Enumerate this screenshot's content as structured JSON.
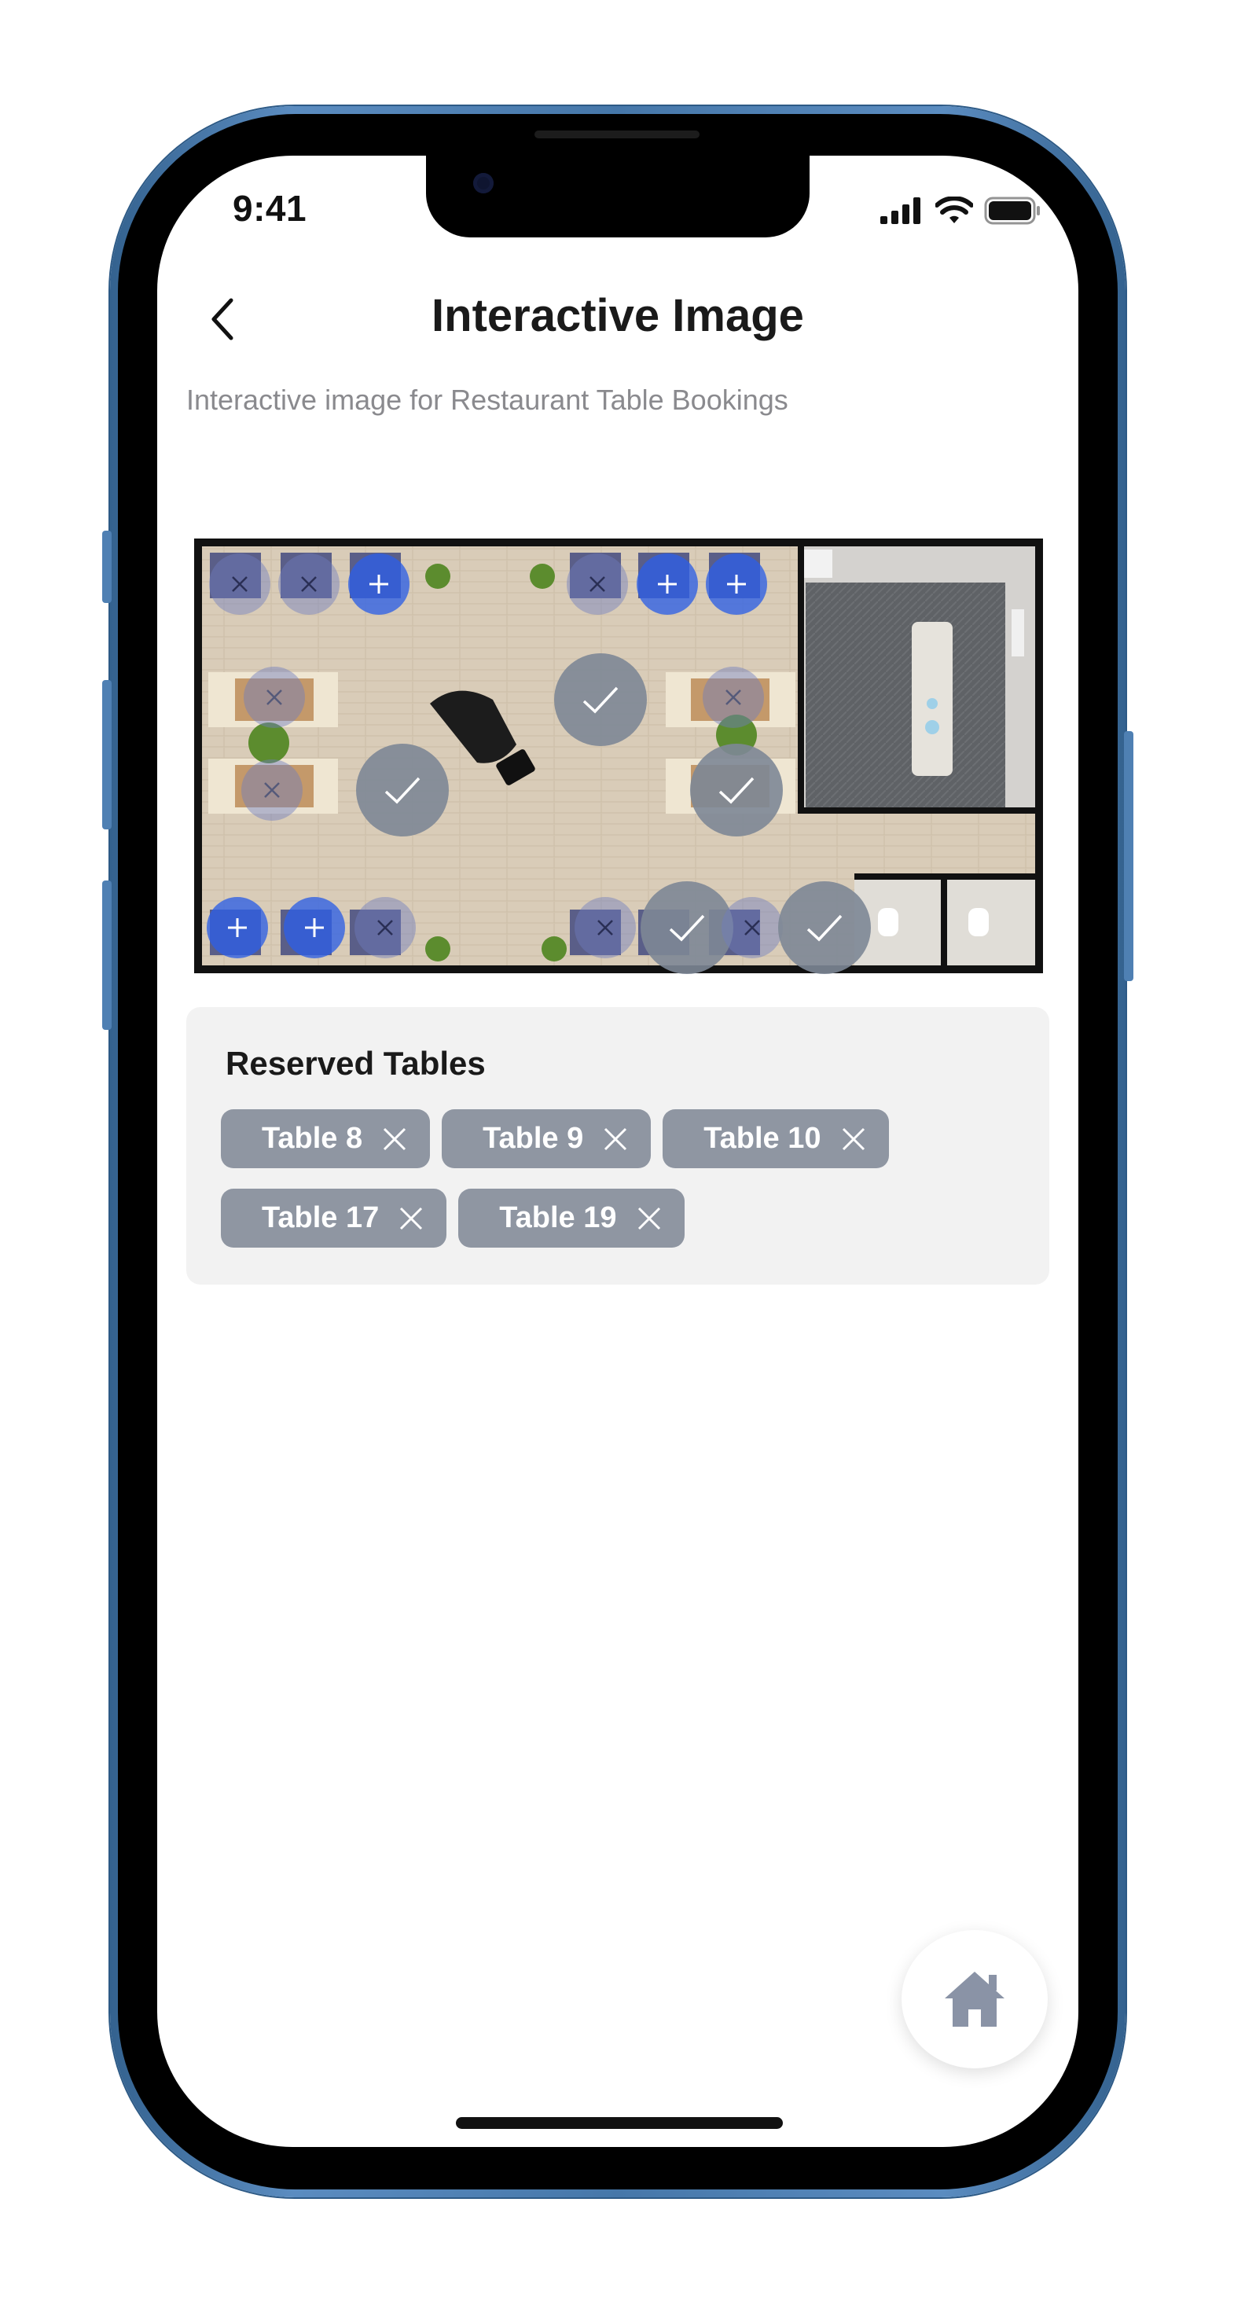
{
  "status_bar": {
    "time": "9:41"
  },
  "header": {
    "title": "Interactive Image",
    "subtitle": "Interactive image for Restaurant Table Bookings"
  },
  "floor_plan": {
    "hotspot_states": {
      "available": "plus-icon",
      "reserved": "x-icon",
      "selected": "check-icon"
    }
  },
  "reserved_panel": {
    "heading": "Reserved Tables",
    "tables": [
      "Table 8",
      "Table 9",
      "Table 10",
      "Table 17",
      "Table 19"
    ]
  },
  "colors": {
    "available": "#2d5fe6",
    "selected": "#7d8796",
    "chip": "#8f96a2",
    "home_icon": "#8a93a6",
    "frame": "#4677a9"
  }
}
